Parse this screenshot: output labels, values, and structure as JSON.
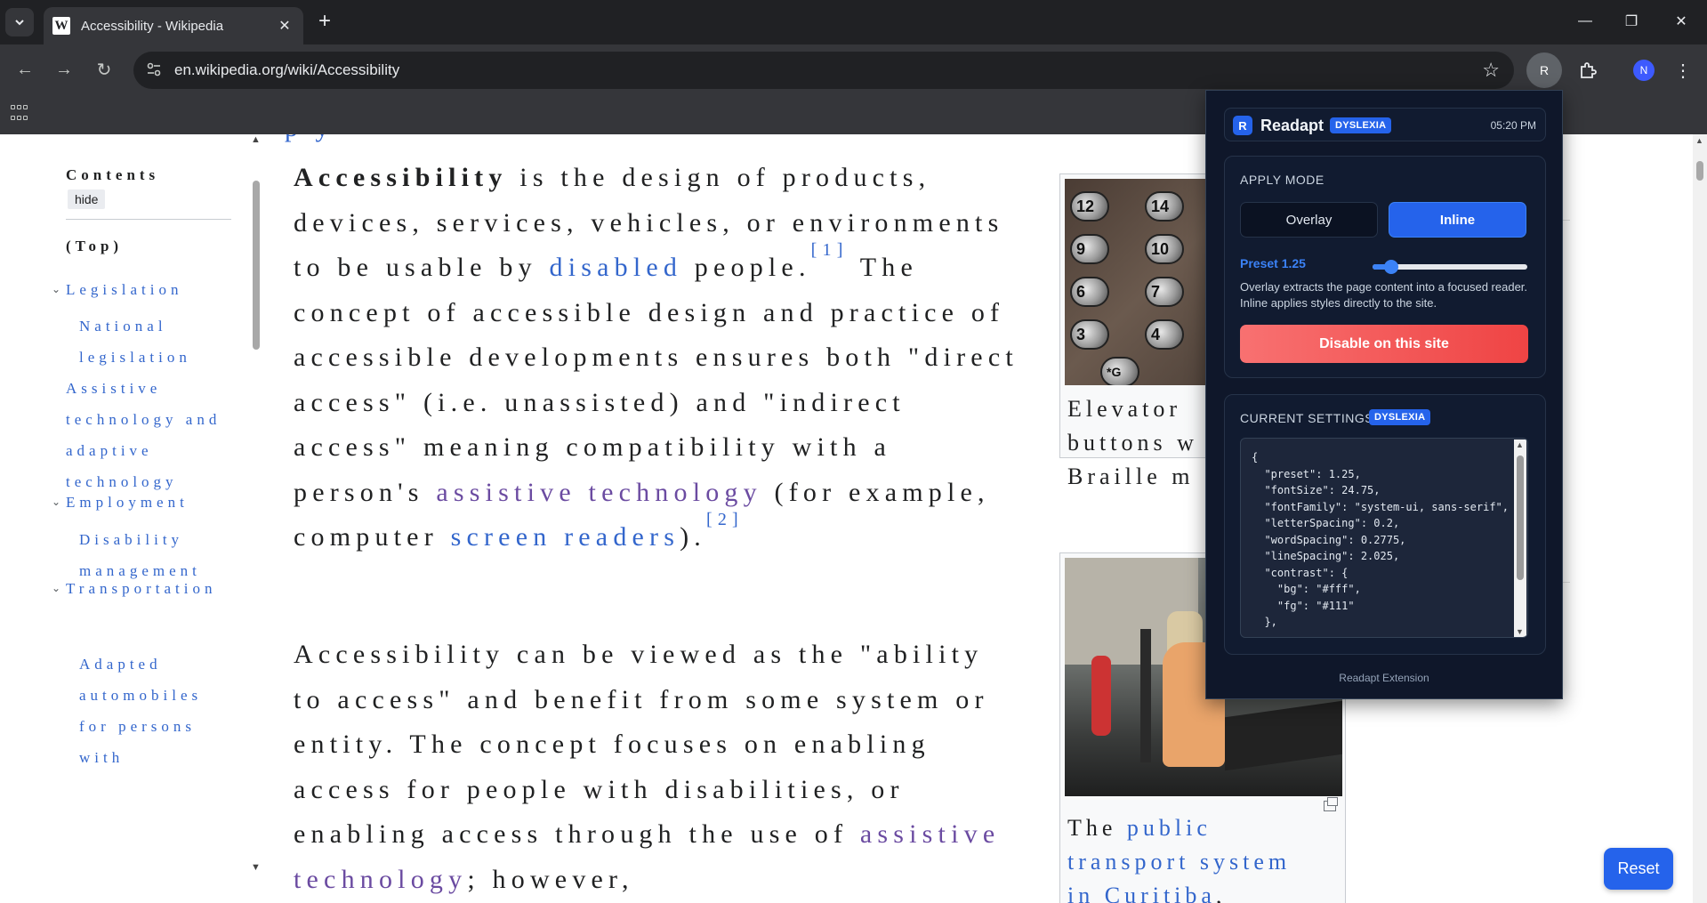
{
  "browser": {
    "tab_title": "Accessibility - Wikipedia",
    "favicon_letter": "W",
    "url": "en.wikipedia.org/wiki/Accessibility",
    "extension_initial": "R",
    "profile_initial": "N"
  },
  "page": {
    "cut_heading": "p                                  y",
    "toc": {
      "title": "Contents",
      "hide_label": "hide",
      "items": [
        {
          "label": "(Top)"
        },
        {
          "label": "Legislation"
        },
        {
          "label": "National legislation"
        },
        {
          "label": "Assistive technology and adaptive technology"
        },
        {
          "label": "Employment"
        },
        {
          "label": "Disability management"
        },
        {
          "label": "Transportation"
        },
        {
          "label": "Adapted automobiles for persons with disabilities"
        }
      ]
    },
    "article": {
      "p1": {
        "t1_bold": "Accessibility",
        "t1": " is the design of products, devices, services, vehicles, or environments to be usable by ",
        "link_disabled": "disabled",
        "t2": " people.",
        "ref1": "[1]",
        "t3": " The concept of accessible design and practice of accessible developments ensures both \"direct access\" (i.e. unassisted) and \"indirect access\" meaning compatibility with a person's ",
        "link_assistive": "assistive technology",
        "t4": " (for example, computer ",
        "link_screen_readers": "screen readers",
        "t5": ").",
        "ref2": "[2]"
      },
      "p2": {
        "t1": "Accessibility can be viewed as the \"ability to access\" and benefit from some system or entity. The concept focuses on enabling access for people with disabilities, or enabling access through the use of ",
        "link_assistive": "assistive technology",
        "t2": "; however,"
      }
    },
    "figures": {
      "elevator_caption": [
        "Elevator",
        "buttons w",
        "Braille m"
      ],
      "elevator_buttons": [
        "12",
        "14",
        "9",
        "10",
        "6",
        "7",
        "3",
        "4",
        "*G"
      ],
      "transport_caption": {
        "line1_text": "The ",
        "line1_link": "public",
        "line2_link": "transport system",
        "line3_link": "in Curitiba",
        "line3_text": ","
      }
    },
    "reset_label": "Reset"
  },
  "readapt": {
    "logo_letter": "R",
    "name": "Readapt",
    "profile_badge": "DYSLEXIA",
    "time": "05:20 PM",
    "apply_mode": {
      "heading": "APPLY MODE",
      "overlay_label": "Overlay",
      "inline_label": "Inline",
      "selected": "Inline"
    },
    "preset": {
      "label": "Preset 1.25",
      "value": 1.25,
      "slider_fraction": 0.12
    },
    "help_text": "Overlay extracts the page content into a focused reader. Inline applies styles directly to the site.",
    "disable_label": "Disable on this site",
    "current_settings": {
      "heading": "CURRENT SETTINGS",
      "badge": "DYSLEXIA",
      "json_text": "{\n  \"preset\": 1.25,\n  \"fontSize\": 24.75,\n  \"fontFamily\": \"system-ui, sans-serif\",\n  \"letterSpacing\": 0.2,\n  \"wordSpacing\": 0.2775,\n  \"lineSpacing\": 2.025,\n  \"contrast\": {\n    \"bg\": \"#fff\",\n    \"fg\": \"#111\"\n  },"
    },
    "footer": "Readapt Extension"
  },
  "colors": {
    "accent": "#2563eb",
    "danger": "#ef4444",
    "link": "#3366cc",
    "link_visited": "#6b4ba1",
    "popup_bg": "#0f172a"
  },
  "icons": [
    "tab-search-icon",
    "wikipedia-favicon-icon",
    "close-icon",
    "plus-icon",
    "minimize-icon",
    "restore-icon",
    "window-close-icon",
    "back-arrow-icon",
    "forward-arrow-icon",
    "reload-icon",
    "site-settings-icon",
    "bookmark-star-icon",
    "puzzle-icon",
    "kebab-menu-icon",
    "apps-grid-icon",
    "chevron-down-icon",
    "enlarge-icon"
  ]
}
